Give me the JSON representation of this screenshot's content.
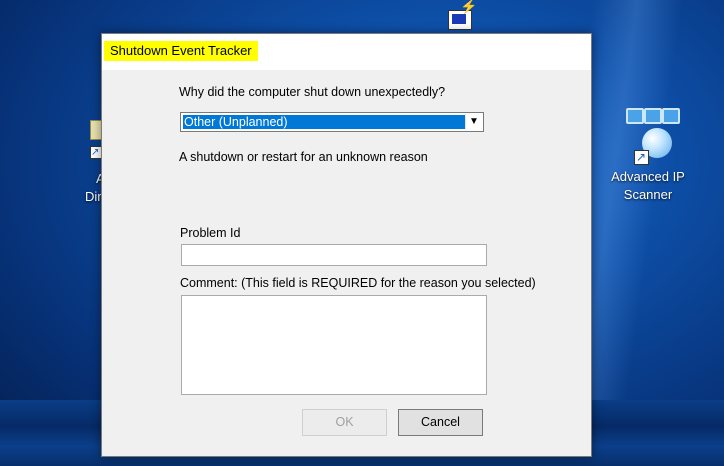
{
  "desktop": {
    "icons": [
      {
        "label_line1": "Advanced IP",
        "label_line2": "Scanner"
      },
      {
        "label_line1": "A",
        "label_line2": "Dir"
      }
    ]
  },
  "dialog": {
    "title": "Shutdown Event Tracker",
    "question": "Why did the computer shut down unexpectedly?",
    "reason_select": {
      "selected": "Other (Unplanned)"
    },
    "reason_description": "A shutdown or restart for an unknown reason",
    "problem_id": {
      "label": "Problem Id",
      "value": ""
    },
    "comment": {
      "label": "Comment: (This field is REQUIRED for the reason you selected)",
      "value": ""
    },
    "buttons": {
      "ok": "OK",
      "cancel": "Cancel"
    }
  },
  "colors": {
    "title_highlight": "#ffff00",
    "selection": "#0078d7",
    "desktop_blue": "#0d4ea6"
  },
  "icons": [
    "network-icon",
    "advanced-ip-scanner-icon",
    "shortcut-arrow-icon",
    "dropdown-arrow-icon"
  ]
}
